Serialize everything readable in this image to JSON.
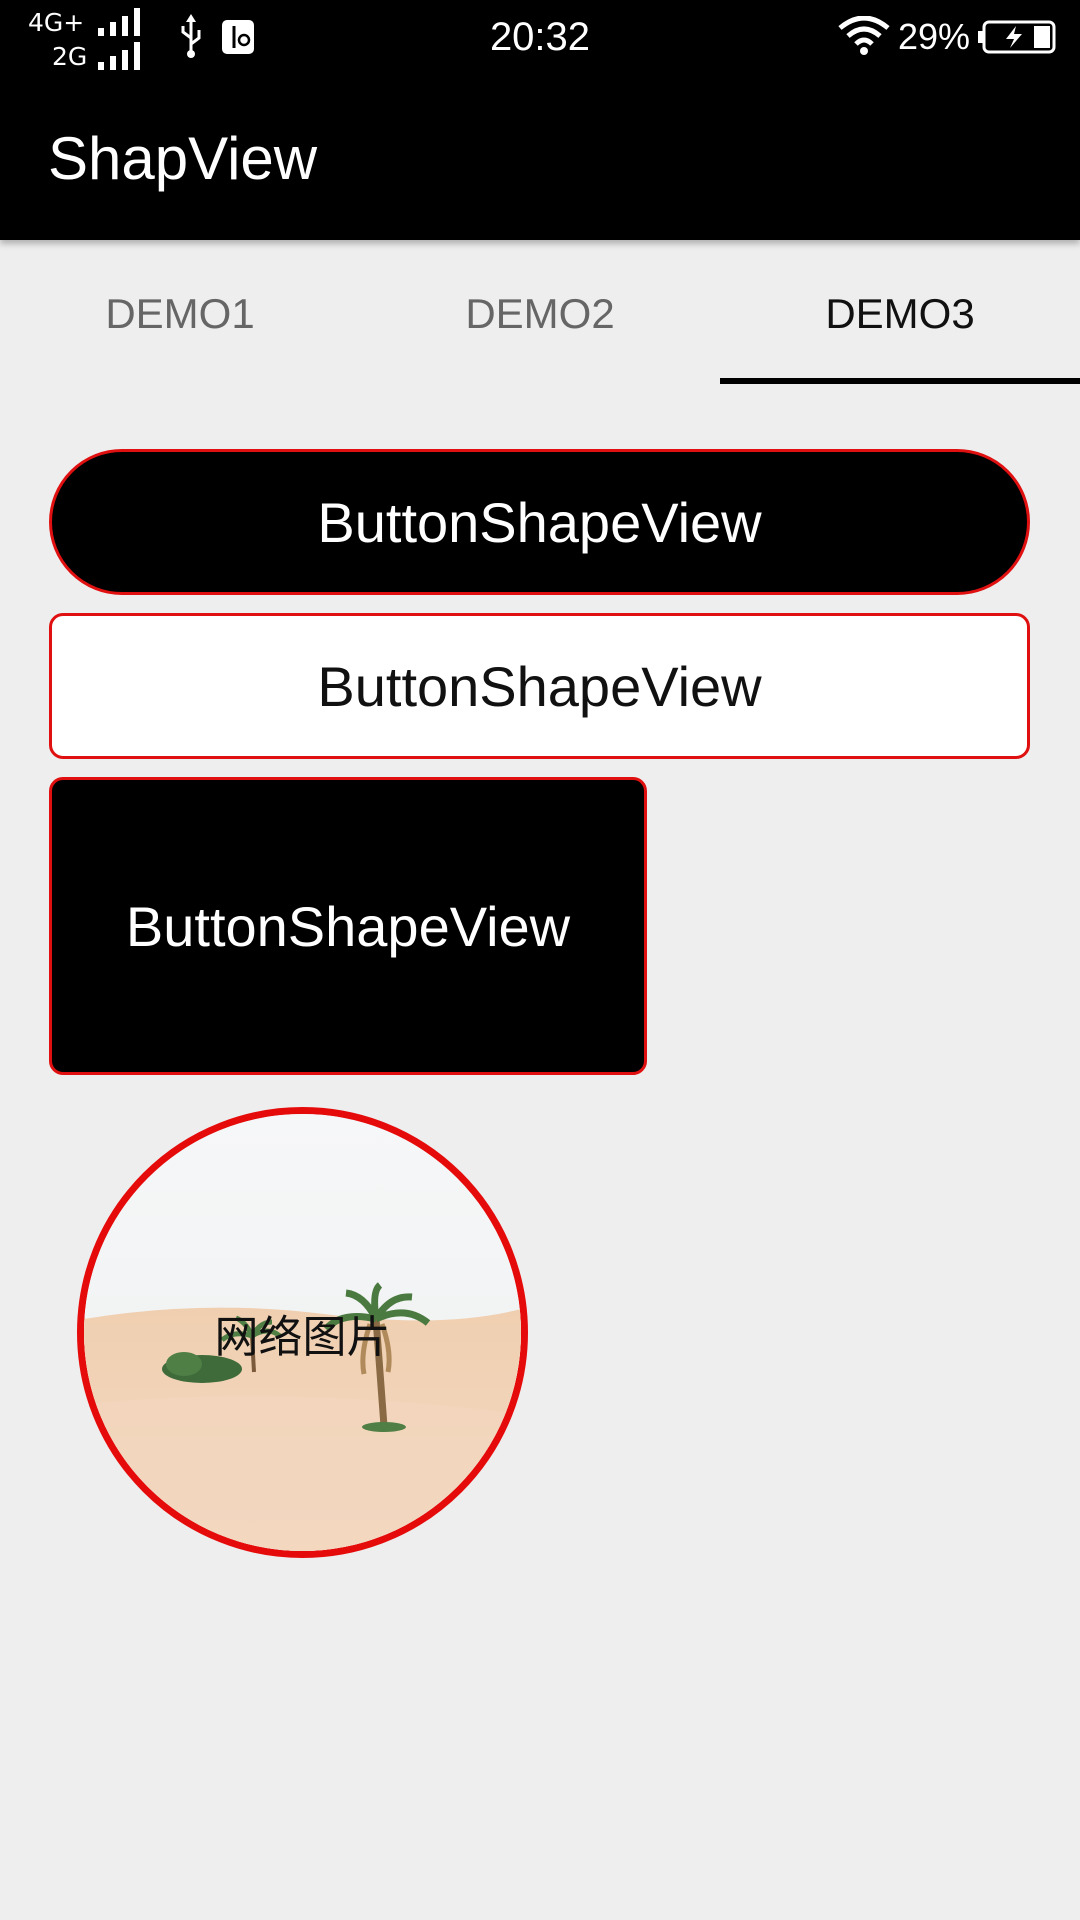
{
  "status_bar": {
    "network_primary": "4G+",
    "network_secondary": "2G",
    "time": "20:32",
    "battery_percent": "29%",
    "icons": [
      "signal-icon",
      "usb-icon",
      "usb-debug-icon",
      "wifi-icon",
      "battery-charging-icon"
    ]
  },
  "app_bar": {
    "title": "ShapView"
  },
  "tabs": [
    {
      "label": "DEMO1",
      "selected": false
    },
    {
      "label": "DEMO2",
      "selected": false
    },
    {
      "label": "DEMO3",
      "selected": true
    }
  ],
  "buttons": [
    {
      "label": "ButtonShapeView",
      "fill": "#000000",
      "text_color": "#ffffff",
      "shape": "pill"
    },
    {
      "label": "ButtonShapeView",
      "fill": "#ffffff",
      "text_color": "#111111",
      "shape": "rounded-rect"
    },
    {
      "label": "ButtonShapeView",
      "fill": "#000000",
      "text_color": "#ffffff",
      "shape": "rounded-rect"
    }
  ],
  "image_view": {
    "label": "网络图片",
    "border_color": "#e60b0b",
    "shape": "circle"
  },
  "colors": {
    "accent_border": "#e01010",
    "background": "#eeeeee",
    "bar_background": "#000000"
  }
}
